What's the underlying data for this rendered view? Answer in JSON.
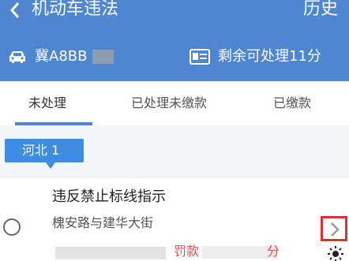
{
  "header": {
    "title": "机动车违法",
    "history_label": "历史",
    "plate": "冀A8BB",
    "remaining": "剩余可处理11分"
  },
  "tabs": [
    {
      "label": "未处理",
      "active": true
    },
    {
      "label": "已处理未缴款",
      "active": false
    },
    {
      "label": "已缴款",
      "active": false
    }
  ],
  "region": {
    "label": "河北 1"
  },
  "violation": {
    "title": "违反禁止标线指示",
    "location": "槐安路与建华大街",
    "fine_label": "罚款",
    "fine_trailing": "分"
  },
  "colors": {
    "header_bg": "#4e86d2",
    "accent": "#3f8de0",
    "fine_text": "#e05050",
    "highlight_box": "#d9342b"
  },
  "icons": [
    "back-icon",
    "car-icon",
    "id-card-icon",
    "radio-icon",
    "chevron-right-icon",
    "sun-icon"
  ]
}
